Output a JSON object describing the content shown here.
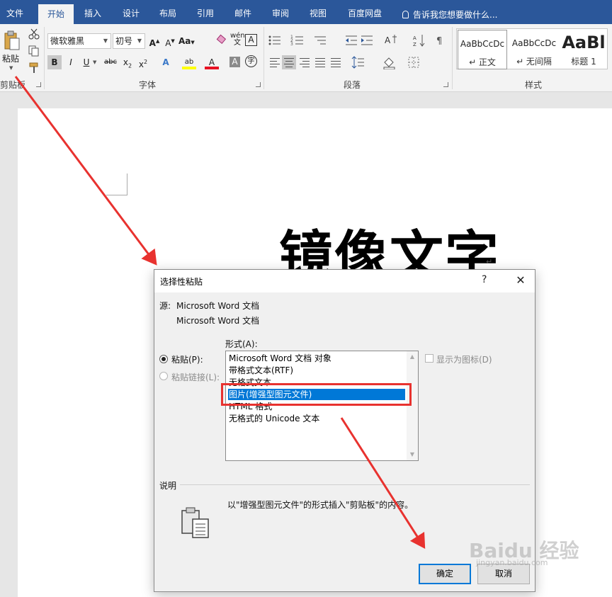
{
  "ribbon_tabs": [
    "文件",
    "开始",
    "插入",
    "设计",
    "布局",
    "引用",
    "邮件",
    "审阅",
    "视图",
    "百度网盘"
  ],
  "tell_me": "告诉我您想要做什么...",
  "clipboard": {
    "paste": "粘贴",
    "group": "剪贴板"
  },
  "font": {
    "name": "微软雅黑",
    "size": "初号",
    "group": "字体"
  },
  "paragraph": {
    "group": "段落"
  },
  "styles": {
    "group": "样式",
    "items": [
      {
        "sample": "AaBbCcDc",
        "name": "↵ 正文"
      },
      {
        "sample": "AaBbCcDc",
        "name": "↵ 无间隔"
      },
      {
        "sample": "AaBl",
        "name": "标题 1"
      }
    ]
  },
  "document": {
    "heading": "镜像文字"
  },
  "dialog": {
    "title": "选择性粘贴",
    "help": "?",
    "close": "✕",
    "source_label": "源:",
    "source_line1": "Microsoft Word 文档",
    "source_line2": "Microsoft Word 文档",
    "as_label": "形式(A):",
    "paste_option": "粘贴(P):",
    "paste_link_option": "粘贴链接(L):",
    "display_as_icon": "显示为图标(D)",
    "formats": [
      "Microsoft Word 文档 对象",
      "带格式文本(RTF)",
      "无格式文本",
      "图片(增强型图元文件)",
      "HTML 格式",
      "无格式的 Unicode 文本"
    ],
    "selected_format": "图片(增强型图元文件)",
    "result_label": "说明",
    "result_text": "以\"增强型图元文件\"的形式插入\"剪贴板\"的内容。",
    "ok": "确定",
    "cancel": "取消"
  },
  "watermark": {
    "text": "Baidu 经验",
    "sub": "jingyan.baidu.com"
  },
  "colors": {
    "ribbon_blue": "#2b579a",
    "selection": "#0078d7",
    "annotation_red": "#e8322f",
    "highlight_yellow": "#ffff00",
    "font_red": "#e81123"
  }
}
